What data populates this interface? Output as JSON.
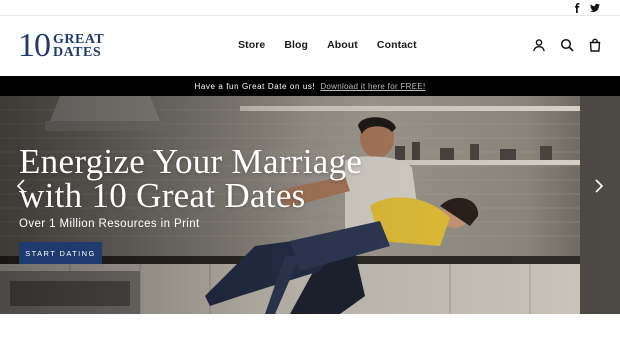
{
  "brand": {
    "logo_number": "10",
    "logo_word_top": "GREAT",
    "logo_word_bottom": "DATES",
    "accent_color": "#1f3a6e"
  },
  "social": {
    "icons": [
      "facebook-icon",
      "twitter-icon"
    ]
  },
  "nav": {
    "items": [
      {
        "label": "Store"
      },
      {
        "label": "Blog"
      },
      {
        "label": "About"
      },
      {
        "label": "Contact"
      }
    ]
  },
  "header_icons": [
    "account-icon",
    "search-icon",
    "cart-icon"
  ],
  "announcement": {
    "text": "Have a fun Great Date on us!",
    "link": "Download it here for FREE!"
  },
  "hero": {
    "title_line1": "Energize Your Marriage",
    "title_line2": "with 10 Great Dates",
    "subtitle": "Over 1 Million Resources in Print",
    "cta_label": "START DATING",
    "prev_icon": "chevron-left-icon",
    "next_icon": "chevron-right-icon"
  }
}
